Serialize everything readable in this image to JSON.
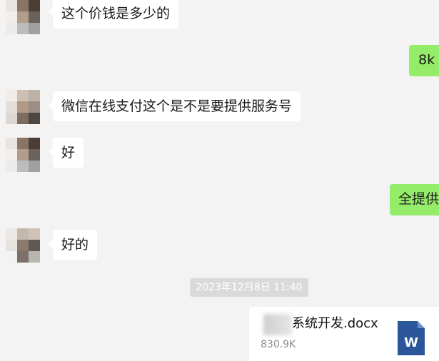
{
  "messages": [
    {
      "side": "in",
      "text": "这个价钱是多少的"
    },
    {
      "side": "out",
      "text": "8k"
    },
    {
      "side": "in",
      "text": "微信在线支付这个是不是要提供服务号"
    },
    {
      "side": "in",
      "text": "好"
    },
    {
      "side": "out",
      "text": "全提供"
    },
    {
      "side": "in",
      "text": "好的"
    }
  ],
  "timestamp": "2023年12月8日 11:40",
  "file": {
    "name": "系统开发.docx",
    "size": "830.9K",
    "icon": "word-doc-icon",
    "icon_letter": "W"
  },
  "colors": {
    "background": "#f3f3f3",
    "incoming_bubble": "#ffffff",
    "outgoing_bubble": "#95ec69",
    "word_blue": "#2b579a"
  }
}
